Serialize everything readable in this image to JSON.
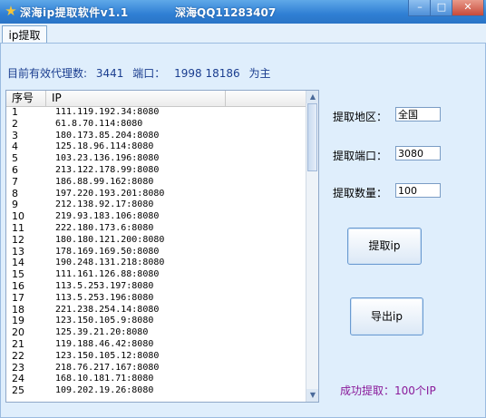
{
  "window": {
    "title": "深海ip提取软件v1.1",
    "qq": "深海QQ11283407",
    "min_label": "–",
    "max_label": "□",
    "close_label": "✕"
  },
  "tabs": [
    {
      "label": "ip提取"
    }
  ],
  "summary": {
    "valid_label": "目前有效代理数:",
    "valid_count": "3441",
    "port_label": "端口：",
    "port_value": "1998 18186",
    "port_suffix": "为主"
  },
  "list": {
    "columns": [
      "序号",
      "IP"
    ],
    "rows": [
      [
        "1",
        "111.119.192.34:8080"
      ],
      [
        "2",
        "61.8.70.114:8080"
      ],
      [
        "3",
        "180.173.85.204:8080"
      ],
      [
        "4",
        "125.18.96.114:8080"
      ],
      [
        "5",
        "103.23.136.196:8080"
      ],
      [
        "6",
        "213.122.178.99:8080"
      ],
      [
        "7",
        "186.88.99.162:8080"
      ],
      [
        "8",
        "197.220.193.201:8080"
      ],
      [
        "9",
        "212.138.92.17:8080"
      ],
      [
        "10",
        "219.93.183.106:8080"
      ],
      [
        "11",
        "222.180.173.6:8080"
      ],
      [
        "12",
        "180.180.121.200:8080"
      ],
      [
        "13",
        "178.169.169.50:8080"
      ],
      [
        "14",
        "190.248.131.218:8080"
      ],
      [
        "15",
        "111.161.126.88:8080"
      ],
      [
        "16",
        "113.5.253.197:8080"
      ],
      [
        "17",
        "113.5.253.196:8080"
      ],
      [
        "18",
        "221.238.254.14:8080"
      ],
      [
        "19",
        "123.150.105.9:8080"
      ],
      [
        "20",
        "125.39.21.20:8080"
      ],
      [
        "21",
        "119.188.46.42:8080"
      ],
      [
        "22",
        "123.150.105.12:8080"
      ],
      [
        "23",
        "218.76.217.167:8080"
      ],
      [
        "24",
        "168.10.181.71:8080"
      ],
      [
        "25",
        "109.202.19.26:8080"
      ]
    ]
  },
  "form": {
    "region_label": "提取地区：",
    "region_value": "全国",
    "port_label": "提取端口：",
    "port_value": "3080",
    "count_label": "提取数量：",
    "count_value": "100"
  },
  "buttons": {
    "fetch": "提取ip",
    "export": "导出ip"
  },
  "status": {
    "success": "成功提取：100个IP"
  }
}
